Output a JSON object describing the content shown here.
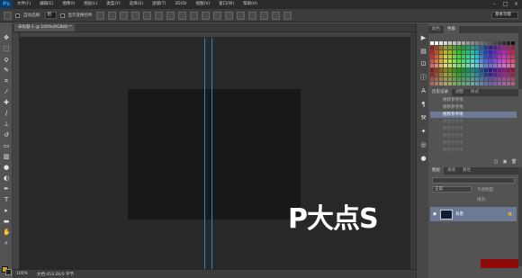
{
  "app": {
    "logo": "Ps"
  },
  "menu": [
    "文件(F)",
    "编辑(E)",
    "图像(I)",
    "图层(L)",
    "类型(Y)",
    "选择(S)",
    "滤镜(T)",
    "3D(D)",
    "视图(V)",
    "窗口(W)",
    "帮助(H)"
  ],
  "window_controls": [
    "–",
    "□",
    "×"
  ],
  "options_bar": {
    "auto_select_label": "自动选择:",
    "auto_select_value": "组",
    "transform_label": "显示变换控件",
    "workspace": "基本功能"
  },
  "document": {
    "tab_label": "未标题-1 @ 100%(RGB/8) *",
    "watermark": "P大点S"
  },
  "status": {
    "zoom": "100%",
    "doc_size": "文档:453.2K/0 字节"
  },
  "tools": [
    "move-icon",
    "marquee-icon",
    "lasso-icon",
    "quick-select-icon",
    "crop-icon",
    "eyedropper-icon",
    "healing-icon",
    "brush-icon",
    "stamp-icon",
    "history-brush-icon",
    "eraser-icon",
    "gradient-icon",
    "blur-icon",
    "dodge-icon",
    "pen-icon",
    "type-icon",
    "path-select-icon",
    "shape-icon",
    "hand-icon",
    "zoom-icon"
  ],
  "colors": {
    "foreground": "#d4a700",
    "background": "#222222",
    "accent": "#2f86c7",
    "selection": "#6d7a96"
  },
  "panels": {
    "swatches_tabs": [
      "颜色",
      "色板"
    ],
    "history_tabs": [
      "历史记录",
      "调整",
      "样式"
    ],
    "history_items": [
      "拖移参考线",
      "拖移参考线",
      "拖移参考线",
      "新建参考线",
      "新建参考线",
      "新建参考线",
      "新建参考线",
      "新建参考线"
    ],
    "layers_tabs": [
      "图层",
      "通道",
      "路径"
    ],
    "blend_mode": "正常",
    "opacity_label": "不透明度:",
    "fill_label": "填充:",
    "layer_name": "背景"
  }
}
